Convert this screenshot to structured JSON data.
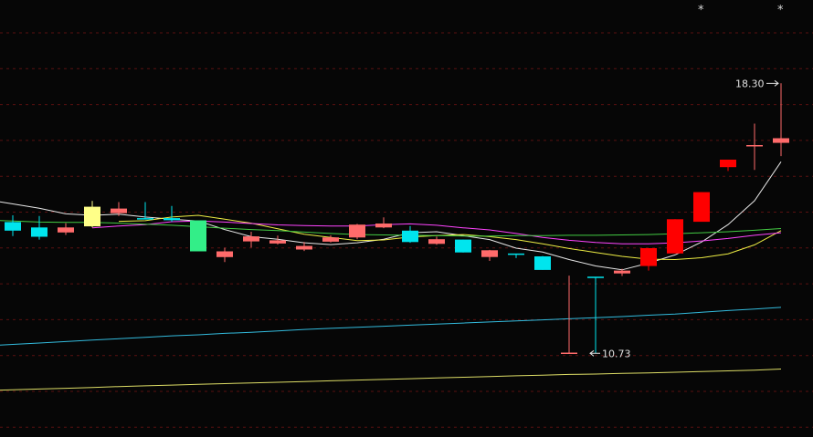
{
  "chart_data": {
    "type": "candlestick",
    "grid": true,
    "grid_style": "dashed horizontal",
    "colors": {
      "background": "#060606",
      "grid": "#5a1010",
      "up_candle": "#ff6b6b",
      "strong_up_candle": "#ff0000",
      "down_candle": "#00e5ee",
      "special_up_candle": "#ffff88",
      "special_down_candle": "#33ee88",
      "ma_white": "#e8e8e8",
      "ma_yellow": "#eeee44",
      "ma_magenta": "#ff44ff",
      "ma_green": "#44cc44",
      "ma_cyan": "#33bbdd",
      "ma_pale_yellow": "#dddd66",
      "annotation": "#e0e0e0"
    },
    "candles": [
      {
        "open": 14.41,
        "close": 14.17,
        "high": 14.6,
        "low": 14.02,
        "color": "down"
      },
      {
        "open": 14.26,
        "close": 14.0,
        "high": 14.58,
        "low": 13.92,
        "color": "down"
      },
      {
        "open": 14.12,
        "close": 14.26,
        "high": 14.38,
        "low": 14.05,
        "color": "up"
      },
      {
        "open": 14.29,
        "close": 14.84,
        "high": 15.0,
        "low": 14.26,
        "color": "special_up"
      },
      {
        "open": 14.66,
        "close": 14.79,
        "high": 14.97,
        "low": 14.58,
        "color": "up"
      },
      {
        "open": 14.5,
        "close": 14.5,
        "high": 14.97,
        "low": 14.5,
        "color": "down"
      },
      {
        "open": 14.52,
        "close": 14.46,
        "high": 14.86,
        "low": 14.42,
        "color": "down"
      },
      {
        "open": 14.46,
        "close": 13.59,
        "high": 14.46,
        "low": 13.59,
        "color": "special_down"
      },
      {
        "open": 13.43,
        "close": 13.59,
        "high": 13.69,
        "low": 13.29,
        "color": "up"
      },
      {
        "open": 13.87,
        "close": 14.01,
        "high": 14.14,
        "low": 13.7,
        "color": "up"
      },
      {
        "open": 13.81,
        "close": 13.9,
        "high": 14.03,
        "low": 13.78,
        "color": "up"
      },
      {
        "open": 13.64,
        "close": 13.74,
        "high": 13.85,
        "low": 13.6,
        "color": "up"
      },
      {
        "open": 13.86,
        "close": 13.98,
        "high": 14.04,
        "low": 13.84,
        "color": "up"
      },
      {
        "open": 13.98,
        "close": 14.34,
        "high": 14.36,
        "low": 13.93,
        "color": "up"
      },
      {
        "open": 14.26,
        "close": 14.37,
        "high": 14.54,
        "low": 14.24,
        "color": "up"
      },
      {
        "open": 14.17,
        "close": 13.85,
        "high": 14.3,
        "low": 13.83,
        "color": "down"
      },
      {
        "open": 13.8,
        "close": 13.93,
        "high": 14.0,
        "low": 13.77,
        "color": "up"
      },
      {
        "open": 13.92,
        "close": 13.56,
        "high": 13.92,
        "low": 13.56,
        "color": "down"
      },
      {
        "open": 13.43,
        "close": 13.62,
        "high": 13.63,
        "low": 13.32,
        "color": "up"
      },
      {
        "open": 13.51,
        "close": 13.46,
        "high": 13.51,
        "low": 13.4,
        "color": "down"
      },
      {
        "open": 13.45,
        "close": 13.07,
        "high": 13.46,
        "low": 13.07,
        "color": "down"
      },
      {
        "open": 10.73,
        "close": 10.73,
        "high": 12.91,
        "low": 10.73,
        "color": "up"
      },
      {
        "open": 12.86,
        "close": 12.86,
        "high": 12.86,
        "low": 10.73,
        "color": "down"
      },
      {
        "open": 12.97,
        "close": 13.05,
        "high": 13.1,
        "low": 12.9,
        "color": "up"
      },
      {
        "open": 13.18,
        "close": 13.68,
        "high": 13.68,
        "low": 13.05,
        "color": "strong_up"
      },
      {
        "open": 13.53,
        "close": 14.49,
        "high": 14.49,
        "low": 13.53,
        "color": "strong_up"
      },
      {
        "open": 14.42,
        "close": 15.25,
        "high": 15.25,
        "low": 14.42,
        "color": "strong_up"
      },
      {
        "open": 15.95,
        "close": 16.16,
        "high": 16.16,
        "low": 15.84,
        "color": "strong_up"
      },
      {
        "open": 16.55,
        "close": 16.55,
        "high": 17.17,
        "low": 15.87,
        "color": "up"
      },
      {
        "open": 16.63,
        "close": 16.76,
        "high": 18.3,
        "low": 16.26,
        "color": "up"
      }
    ],
    "moving_averages": [
      {
        "color": "ma_white",
        "values": [
          14.92,
          14.8,
          14.64,
          14.6,
          14.63,
          14.55,
          14.49,
          14.44,
          14.2,
          14.0,
          13.93,
          13.83,
          13.78,
          13.83,
          13.93,
          14.11,
          14.14,
          14.03,
          13.92,
          13.68,
          13.57,
          13.36,
          13.18,
          13.07,
          13.26,
          13.49,
          13.85,
          14.34,
          15.01,
          16.1
        ]
      },
      {
        "color": "ma_yellow",
        "values": [
          null,
          null,
          null,
          null,
          14.43,
          14.45,
          14.55,
          14.6,
          14.49,
          14.38,
          14.22,
          14.07,
          13.98,
          13.89,
          13.91,
          13.99,
          14.03,
          14.06,
          14.0,
          13.92,
          13.8,
          13.67,
          13.56,
          13.45,
          13.37,
          13.36,
          13.41,
          13.52,
          13.77,
          14.17
        ]
      },
      {
        "color": "ma_magenta",
        "values": [
          null,
          null,
          null,
          14.25,
          14.3,
          14.34,
          14.42,
          14.44,
          14.41,
          14.37,
          14.33,
          14.31,
          14.3,
          14.3,
          14.34,
          14.36,
          14.32,
          14.25,
          14.19,
          14.09,
          13.98,
          13.9,
          13.84,
          13.8,
          13.8,
          13.83,
          13.88,
          13.95,
          14.04,
          14.11
        ]
      },
      {
        "color": "ma_green",
        "values": [
          14.44,
          14.41,
          14.4,
          14.4,
          14.38,
          14.35,
          14.32,
          14.28,
          14.24,
          14.2,
          14.17,
          14.13,
          14.09,
          14.06,
          14.05,
          14.04,
          14.03,
          14.02,
          14.02,
          14.03,
          14.03,
          14.04,
          14.04,
          14.05,
          14.06,
          14.08,
          14.11,
          14.14,
          14.18,
          14.23
        ]
      },
      {
        "color": "ma_cyan",
        "values": [
          10.98,
          11.02,
          11.06,
          11.1,
          11.14,
          11.18,
          11.22,
          11.25,
          11.29,
          11.32,
          11.36,
          11.4,
          11.43,
          11.46,
          11.49,
          11.52,
          11.55,
          11.58,
          11.61,
          11.64,
          11.67,
          11.7,
          11.73,
          11.76,
          11.8,
          11.83,
          11.88,
          11.93,
          11.97,
          12.02
        ]
      },
      {
        "color": "ma_pale_yellow",
        "values": [
          9.71,
          9.73,
          9.75,
          9.77,
          9.8,
          9.82,
          9.84,
          9.86,
          9.88,
          9.9,
          9.92,
          9.94,
          9.96,
          9.98,
          10.0,
          10.02,
          10.04,
          10.06,
          10.08,
          10.1,
          10.12,
          10.14,
          10.15,
          10.17,
          10.18,
          10.2,
          10.22,
          10.24,
          10.26,
          10.29
        ]
      }
    ],
    "annotations": {
      "high": {
        "label": "18.30",
        "value": 18.3,
        "candle_index": 29
      },
      "low": {
        "label": "10.73",
        "value": 10.73,
        "candle_index": 22
      },
      "star_markers": [
        26,
        29
      ],
      "star_glyph": "*"
    }
  }
}
